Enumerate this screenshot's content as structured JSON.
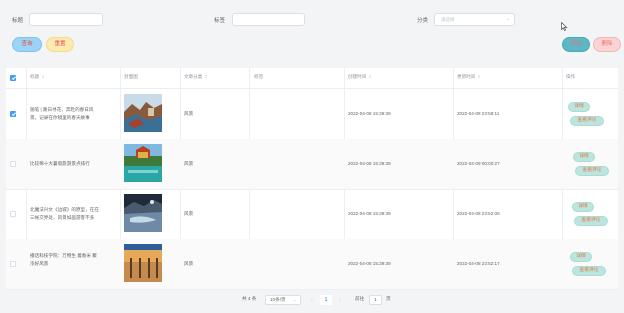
{
  "filters": {
    "title_label": "标题",
    "title_value": "",
    "tag_label": "标签",
    "tag_value": "",
    "category_label": "分类",
    "category_placeholder": "请选择"
  },
  "buttons": {
    "search": "查询",
    "reset": "重置",
    "add": "添加",
    "delete": "删除"
  },
  "table": {
    "headers": {
      "title": "标题",
      "cover": "封面图",
      "category": "文章分类",
      "tag": "标签",
      "created": "创建时间",
      "updated": "更新时间",
      "ops": "操作"
    },
    "rows": [
      {
        "selected": true,
        "title": "随笔 | 路日寻花，奔赴的春日风景，记录在你镜里的春天故事",
        "category": "风景",
        "tag": "",
        "created": "2022-04-08 15:39:39",
        "updated": "2022-04-08 23:58:11"
      },
      {
        "selected": false,
        "title": "比较稀十大暑假旅游景点排行",
        "category": "风景",
        "tag": "",
        "created": "2022-04-08 15:39:39",
        "updated": "2022-04-09 00:00:27"
      },
      {
        "selected": false,
        "title": "北魔法兴文《边城》的原型，在在三帐交界处，风景如画游客不多",
        "category": "风景",
        "tag": "",
        "created": "2022-04-08 15:39:39",
        "updated": "2022-04-08 23:52:06"
      },
      {
        "selected": false,
        "title": "播话科技学院：万物生 着春米 聚浓好风景",
        "category": "风景",
        "tag": "",
        "created": "2022-04-08 15:39:39",
        "updated": "2022-04-08 23:52:17"
      }
    ],
    "detail_label": "详情",
    "comments_label": "查看评论"
  },
  "pagination": {
    "total": "共 4 条",
    "page_size": "10条/页",
    "current_page": "1",
    "goto_label": "前往",
    "goto_value": "1",
    "page_suffix": "页"
  },
  "icons": {
    "select": "chevron-down-icon",
    "sort": "sort-caret-icon",
    "prev": "chevron-left-icon",
    "next": "chevron-right-icon"
  },
  "colors": {
    "primary": "#409eff",
    "action_button_bg": "#bde5e0",
    "action_button_text": "#e6743b"
  }
}
